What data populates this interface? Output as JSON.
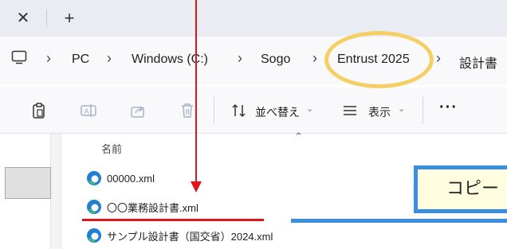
{
  "tabs": {
    "close_glyph": "✕",
    "new_glyph": "+"
  },
  "breadcrumb": {
    "items": [
      "PC",
      "Windows (C:)",
      "Sogo",
      "Entrust 2025",
      "設計書"
    ],
    "separator": "›"
  },
  "commandbar": {
    "sort_label": "並べ替え",
    "view_label": "表示",
    "more_label": "···",
    "chevron": "⌄"
  },
  "filelist": {
    "column_name": "名前",
    "sort_caret": "⌃",
    "files": [
      "00000.xml",
      "〇〇業務設計書.xml",
      "サンプル設計書（国交省）2024.xml"
    ]
  },
  "annotation": {
    "callout_text": "コピー"
  },
  "colors": {
    "arrow": "#e0141b",
    "highlight_ellipse": "#f5cf64",
    "callout_border": "#3a8ee0",
    "callout_fill": "#fffde0",
    "edge_icon": "#1f7fd2"
  }
}
